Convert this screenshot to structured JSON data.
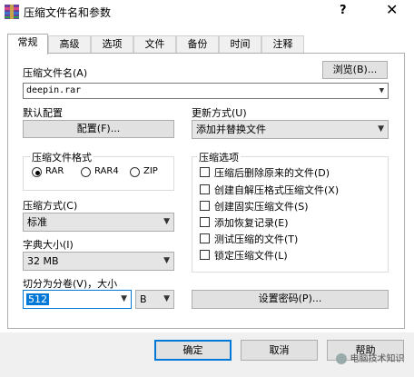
{
  "window": {
    "title": "压缩文件名和参数",
    "help_label": "?",
    "close_label": "✕"
  },
  "tabs": [
    {
      "label": "常规",
      "active": true
    },
    {
      "label": "高级"
    },
    {
      "label": "选项"
    },
    {
      "label": "文件"
    },
    {
      "label": "备份"
    },
    {
      "label": "时间"
    },
    {
      "label": "注释"
    }
  ],
  "archive": {
    "name_label": "压缩文件名(A)",
    "browse_label": "浏览(B)...",
    "name_value": "deepin.rar"
  },
  "default_config": {
    "label": "默认配置",
    "button_label": "配置(F)..."
  },
  "update_mode": {
    "label": "更新方式(U)",
    "value": "添加并替换文件"
  },
  "format": {
    "legend": "压缩文件格式",
    "options": [
      {
        "label": "RAR",
        "selected": true
      },
      {
        "label": "RAR4",
        "selected": false
      },
      {
        "label": "ZIP",
        "selected": false
      }
    ]
  },
  "options_group": {
    "legend": "压缩选项",
    "items": [
      {
        "label": "压缩后删除原来的文件(D)",
        "checked": false
      },
      {
        "label": "创建自解压格式压缩文件(X)",
        "checked": false
      },
      {
        "label": "创建固实压缩文件(S)",
        "checked": false
      },
      {
        "label": "添加恢复记录(E)",
        "checked": false
      },
      {
        "label": "测试压缩的文件(T)",
        "checked": false
      },
      {
        "label": "锁定压缩文件(L)",
        "checked": false
      }
    ]
  },
  "method": {
    "label": "压缩方式(C)",
    "value": "标准"
  },
  "dict": {
    "label": "字典大小(I)",
    "value": "32 MB"
  },
  "split": {
    "label": "切分为分卷(V)，大小",
    "value": "512",
    "unit": "B"
  },
  "password_button": "设置密码(P)...",
  "footer": {
    "ok": "确定",
    "cancel": "取消",
    "help": "帮助"
  },
  "watermark": "电脑技术知识"
}
